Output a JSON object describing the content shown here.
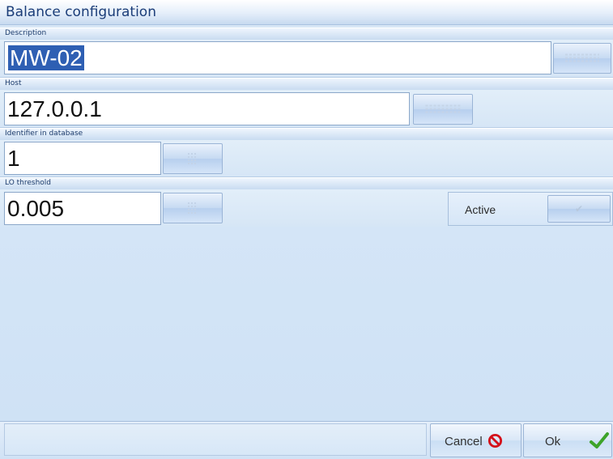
{
  "window": {
    "title": "Balance configuration"
  },
  "description": {
    "label": "Description",
    "value": "MW-02"
  },
  "host": {
    "label": "Host",
    "value": "127.0.0.1"
  },
  "identifier": {
    "label": "Identifier in database",
    "value": "1"
  },
  "lo_threshold": {
    "label": "LO threshold",
    "value": "0.005"
  },
  "active": {
    "label": "Active"
  },
  "footer": {
    "cancel_label": "Cancel",
    "ok_label": "Ok"
  },
  "colors": {
    "cancel_red": "#d4101a",
    "ok_green": "#3da32a",
    "title_blue": "#1b3d78"
  }
}
